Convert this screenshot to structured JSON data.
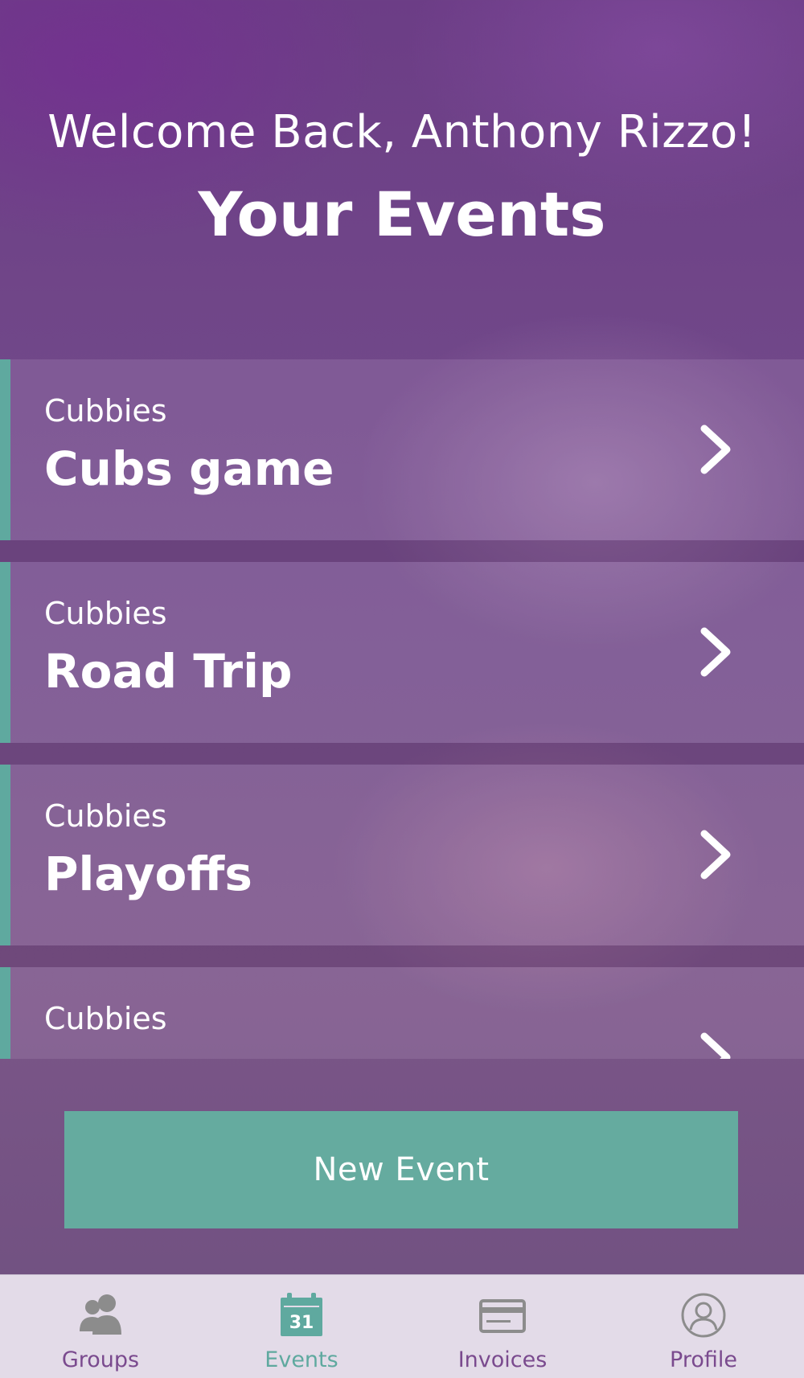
{
  "header": {
    "welcome": "Welcome Back, Anthony Rizzo!",
    "title": "Your Events"
  },
  "events": [
    {
      "group": "Cubbies",
      "name": "Cubs game"
    },
    {
      "group": "Cubbies",
      "name": "Road Trip"
    },
    {
      "group": "Cubbies",
      "name": "Playoffs"
    },
    {
      "group": "Cubbies",
      "name": ""
    }
  ],
  "new_event_button": "New Event",
  "tabs": [
    {
      "label": "Groups",
      "icon": "groups-icon",
      "active": false
    },
    {
      "label": "Events",
      "icon": "calendar-icon",
      "icon_text": "31",
      "active": true
    },
    {
      "label": "Invoices",
      "icon": "credit-card-icon",
      "active": false
    },
    {
      "label": "Profile",
      "icon": "profile-icon",
      "active": false
    }
  ],
  "colors": {
    "accent": "#65ab9f",
    "tab_label": "#7a4a8e",
    "tab_bar_bg": "#e3dbe8",
    "icon_gray": "#8c8c8c"
  }
}
